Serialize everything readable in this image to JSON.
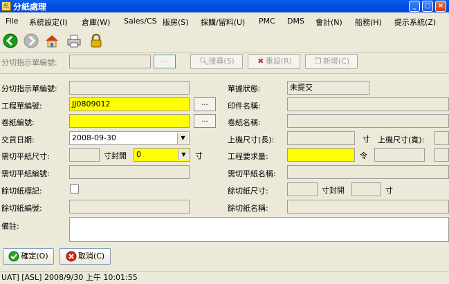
{
  "window": {
    "title": "分紙處理"
  },
  "menu": [
    "File",
    "系統設定(I)",
    "倉庫(W)",
    "Sales/CS",
    "版房(S)",
    "採購/留料(U)",
    "PMC",
    "DMS",
    "會計(N)",
    "船務(H)",
    "提示系統(Z)"
  ],
  "search": {
    "label": "分切指示單編號:",
    "dots": "...",
    "search_button": "搜尋(S)",
    "reset_button": "重設(R)",
    "new_button": "新增(C)"
  },
  "form": {
    "order_no_label": "分切指示單編號:",
    "status_label": "單據狀態:",
    "status_value": "未提交",
    "work_order_label": "工程單編號:",
    "work_order_value": "JJ0809012",
    "print_name_label": "印件名稱:",
    "roll_no_label": "卷紙編號:",
    "roll_name_label": "卷紙名稱:",
    "delivery_label": "交貨日期:",
    "delivery_value": "2008-09-30",
    "machine_len_label": "上機尺寸(長):",
    "unit_inch": "寸",
    "machine_wid_label": "上機尺寸(寬):",
    "cut_size_label": "需切平紙尺寸:",
    "cut_open_label": "寸封開",
    "cut_open_value": "0",
    "req_qty_label": "工程要求量:",
    "unit_ream": "令",
    "cut_no_label": "需切平紙編號:",
    "cut_name_label": "需切平紙名稱:",
    "remain_flag_label": "餘切紙標記:",
    "remain_size_label": "餘切紙尺寸:",
    "remain_no_label": "餘切紙編號:",
    "remain_name_label": "餘切紙名稱:",
    "remark_label": "備註:",
    "dots": "..."
  },
  "actions": {
    "ok": "確定(O)",
    "cancel": "取消(C)"
  },
  "status_bar": "UAT] [ASL] 2008/9/30 上午 10:01:55"
}
